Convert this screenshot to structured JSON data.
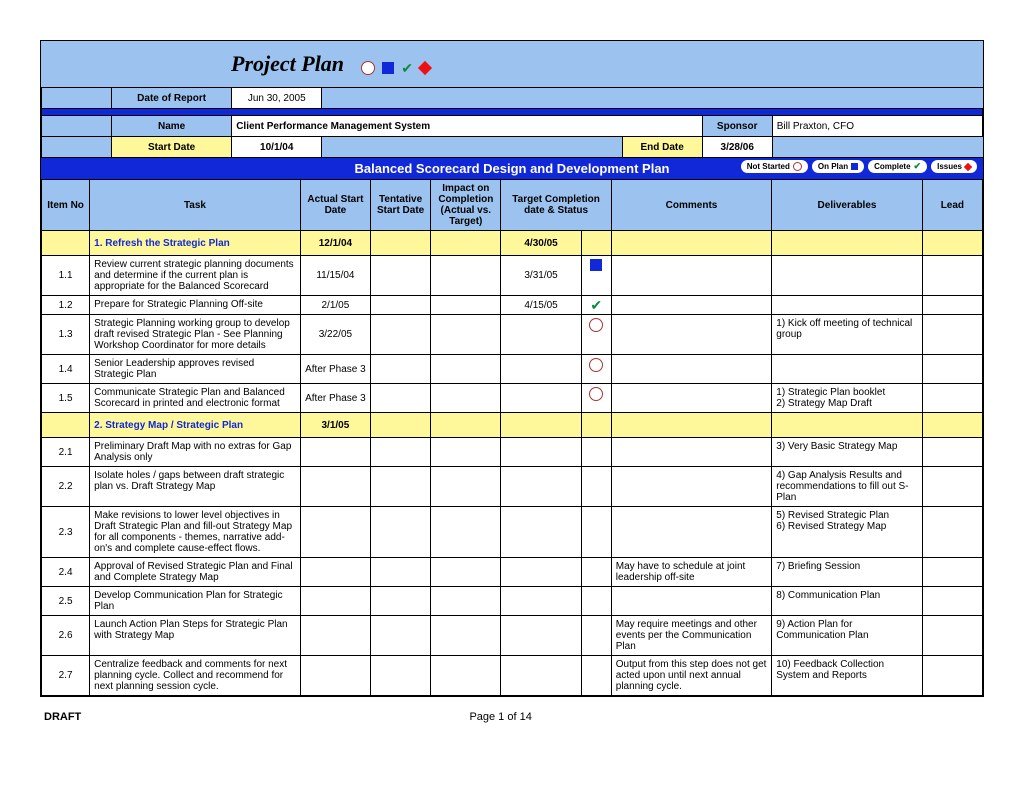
{
  "title": "Project Plan",
  "meta": {
    "dateOfReportLabel": "Date of Report",
    "dateOfReport": "Jun 30, 2005",
    "nameLabel": "Name",
    "name": "Client Performance Management System",
    "sponsorLabel": "Sponsor",
    "sponsor": "Bill Praxton, CFO",
    "startDateLabel": "Start Date",
    "startDate": "10/1/04",
    "endDateLabel": "End Date",
    "endDate": "3/28/06"
  },
  "sectionTitle": "Balanced Scorecard Design and Development Plan",
  "legend": {
    "notStarted": "Not Started",
    "onPlan": "On Plan",
    "complete": "Complete",
    "issues": "Issues"
  },
  "columns": {
    "itemNo": "Item No",
    "task": "Task",
    "actualStart": "Actual Start Date",
    "tentativeStart": "Tentative Start Date",
    "impact": "Impact on Completion (Actual vs. Target)",
    "target": "Target Completion date & Status",
    "comments": "Comments",
    "deliverables": "Deliverables",
    "lead": "Lead"
  },
  "groups": [
    {
      "heading": "1. Refresh the Strategic Plan",
      "actualStart": "12/1/04",
      "target": "4/30/05",
      "rows": [
        {
          "item": "1.1",
          "task": "Review current strategic planning documents and determine if the current plan is appropriate for the Balanced Scorecard",
          "actualStart": "11/15/04",
          "tentativeStart": "",
          "impact": "",
          "target": "3/31/05",
          "status": "square",
          "comments": "",
          "deliverables": "",
          "lead": ""
        },
        {
          "item": "1.2",
          "task": "Prepare for Strategic Planning Off-site",
          "actualStart": "2/1/05",
          "tentativeStart": "",
          "impact": "",
          "target": "4/15/05",
          "status": "check",
          "comments": "",
          "deliverables": "",
          "lead": ""
        },
        {
          "item": "1.3",
          "task": "Strategic Planning working group to develop draft revised Strategic Plan - See Planning Workshop Coordinator for more details",
          "actualStart": "3/22/05",
          "tentativeStart": "",
          "impact": "",
          "target": "",
          "status": "circle",
          "comments": "",
          "deliverables": "1) Kick off meeting of technical group",
          "lead": ""
        },
        {
          "item": "1.4",
          "task": "Senior Leadership approves revised Strategic Plan",
          "actualStart": "After Phase 3",
          "tentativeStart": "",
          "impact": "",
          "target": "",
          "status": "circle",
          "comments": "",
          "deliverables": "",
          "lead": ""
        },
        {
          "item": "1.5",
          "task": "Communicate Strategic Plan and Balanced Scorecard in printed and electronic format",
          "actualStart": "After Phase 3",
          "tentativeStart": "",
          "impact": "",
          "target": "",
          "status": "circle",
          "comments": "",
          "deliverables": "1) Strategic Plan booklet\n2) Strategy Map Draft",
          "lead": ""
        }
      ]
    },
    {
      "heading": "2. Strategy Map / Strategic Plan",
      "actualStart": "3/1/05",
      "target": "",
      "rows": [
        {
          "item": "2.1",
          "task": "Preliminary Draft Map with no extras for Gap Analysis only",
          "actualStart": "",
          "tentativeStart": "",
          "impact": "",
          "target": "",
          "status": "",
          "comments": "",
          "deliverables": "3) Very Basic Strategy Map",
          "lead": ""
        },
        {
          "item": "2.2",
          "task": "Isolate holes / gaps between draft strategic plan vs. Draft Strategy Map",
          "actualStart": "",
          "tentativeStart": "",
          "impact": "",
          "target": "",
          "status": "",
          "comments": "",
          "deliverables": "4) Gap Analysis Results and recommendations to fill out S-Plan",
          "lead": ""
        },
        {
          "item": "2.3",
          "task": "Make revisions to lower level objectives in Draft Strategic Plan and fill-out Strategy Map for all components - themes, narrative add-on's and complete cause-effect flows.",
          "actualStart": "",
          "tentativeStart": "",
          "impact": "",
          "target": "",
          "status": "",
          "comments": "",
          "deliverables": "5) Revised Strategic Plan\n6) Revised Strategy Map",
          "lead": ""
        },
        {
          "item": "2.4",
          "task": "Approval of Revised Strategic Plan and Final and Complete Strategy Map",
          "actualStart": "",
          "tentativeStart": "",
          "impact": "",
          "target": "",
          "status": "",
          "comments": "May have to schedule at joint leadership off-site",
          "deliverables": "7) Briefing Session",
          "lead": ""
        },
        {
          "item": "2.5",
          "task": "Develop Communication Plan for Strategic Plan",
          "actualStart": "",
          "tentativeStart": "",
          "impact": "",
          "target": "",
          "status": "",
          "comments": "",
          "deliverables": "8) Communication Plan",
          "lead": ""
        },
        {
          "item": "2.6",
          "task": "Launch Action Plan Steps for Strategic Plan with Strategy Map",
          "actualStart": "",
          "tentativeStart": "",
          "impact": "",
          "target": "",
          "status": "",
          "comments": "May require meetings and other events per the Communication Plan",
          "deliverables": "9) Action Plan for Communication Plan",
          "lead": ""
        },
        {
          "item": "2.7",
          "task": "Centralize feedback and comments for next planning cycle. Collect and recommend for next planning session cycle.",
          "actualStart": "",
          "tentativeStart": "",
          "impact": "",
          "target": "",
          "status": "",
          "comments": "Output from this step does not get acted upon until next annual planning cycle.",
          "deliverables": "10) Feedback Collection System and Reports",
          "lead": ""
        }
      ]
    }
  ],
  "footer": {
    "left": "DRAFT",
    "center": "Page 1 of 14"
  }
}
